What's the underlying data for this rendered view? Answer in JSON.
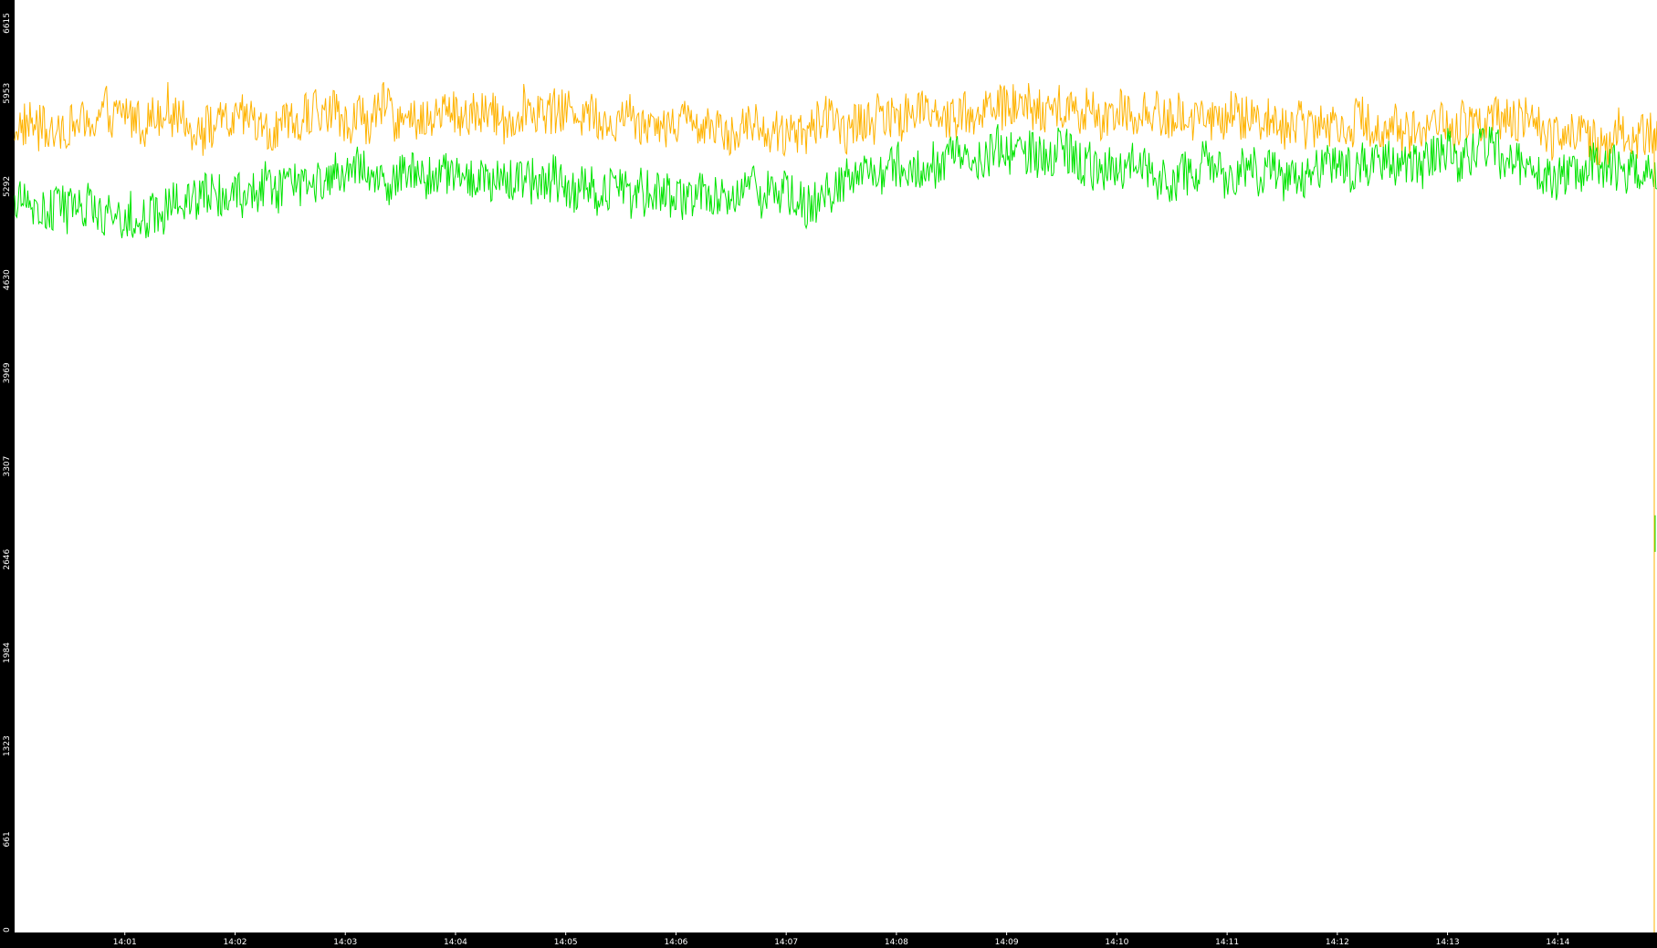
{
  "colors": {
    "background": "#000000",
    "plot_background": "#ffffff",
    "series_orange": "#ffb300",
    "series_green": "#00e400",
    "tick_text": "#ffffff"
  },
  "chart_data": {
    "type": "line",
    "title": "",
    "xlabel": "",
    "ylabel": "",
    "ylim": [
      0,
      6615
    ],
    "y_ticks": [
      "0",
      "661",
      "1323",
      "1984",
      "2646",
      "3307",
      "3969",
      "4630",
      "5292",
      "5953",
      "6615"
    ],
    "x_ticks": [
      "14:01",
      "14:02",
      "14:03",
      "14:04",
      "14:05",
      "14:06",
      "14:07",
      "14:08",
      "14:09",
      "14:10",
      "14:11",
      "14:12",
      "14:13",
      "14:14"
    ],
    "legend": "none",
    "grid": false,
    "series": [
      {
        "color_key": "series_orange",
        "approx_profile_minutes": [
          14.0,
          14.25,
          14.5,
          14.75,
          15.0
        ],
        "samples": [
          {
            "t": "14:00",
            "v": 5700
          },
          {
            "t": "14:01",
            "v": 5750
          },
          {
            "t": "14:02",
            "v": 5760
          },
          {
            "t": "14:03",
            "v": 5780
          },
          {
            "t": "14:04",
            "v": 5810
          },
          {
            "t": "14:05",
            "v": 5830
          },
          {
            "t": "14:06",
            "v": 5790
          },
          {
            "t": "14:07",
            "v": 5690
          },
          {
            "t": "14:08",
            "v": 5810
          },
          {
            "t": "14:09",
            "v": 5850
          },
          {
            "t": "14:10",
            "v": 5800
          },
          {
            "t": "14:11",
            "v": 5780
          },
          {
            "t": "14:12",
            "v": 5740
          },
          {
            "t": "14:13",
            "v": 5720
          },
          {
            "t": "14:14",
            "v": 5700
          },
          {
            "t": "14:15",
            "v": 5650
          }
        ]
      },
      {
        "color_key": "series_green",
        "samples": [
          {
            "t": "14:00",
            "v": 5150
          },
          {
            "t": "14:01",
            "v": 5120
          },
          {
            "t": "14:02",
            "v": 5250
          },
          {
            "t": "14:03",
            "v": 5350
          },
          {
            "t": "14:04",
            "v": 5360
          },
          {
            "t": "14:05",
            "v": 5330
          },
          {
            "t": "14:06",
            "v": 5220
          },
          {
            "t": "14:07",
            "v": 5230
          },
          {
            "t": "14:08",
            "v": 5400
          },
          {
            "t": "14:09",
            "v": 5550
          },
          {
            "t": "14:10",
            "v": 5420
          },
          {
            "t": "14:11",
            "v": 5380
          },
          {
            "t": "14:12",
            "v": 5420
          },
          {
            "t": "14:13",
            "v": 5500
          },
          {
            "t": "14:14",
            "v": 5440
          },
          {
            "t": "14:15",
            "v": 5400
          }
        ]
      }
    ]
  }
}
